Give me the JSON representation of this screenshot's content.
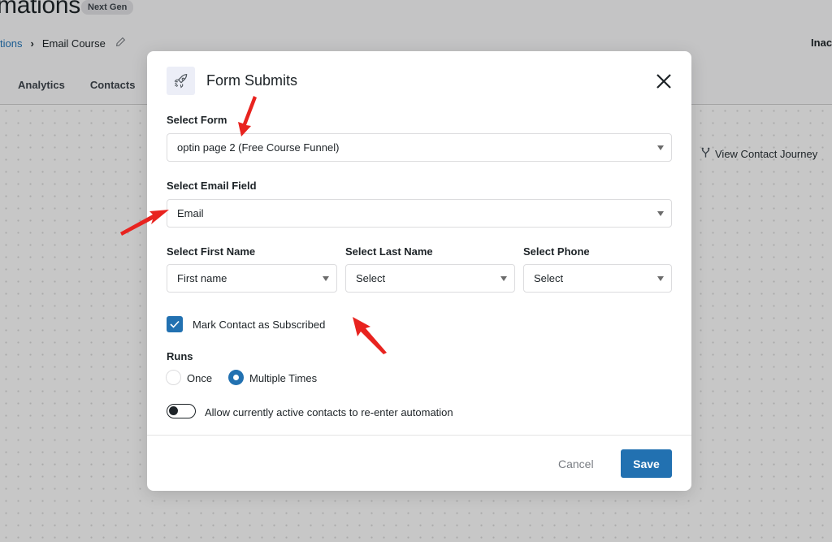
{
  "page": {
    "title": "mations",
    "badge": "Next Gen",
    "breadcrumb": {
      "parent": "tions",
      "separator": "›",
      "current": "Email Course"
    },
    "status": "Inacti",
    "tabs": [
      {
        "label": "Analytics"
      },
      {
        "label": "Contacts"
      }
    ],
    "view_journey": "View Contact Journey"
  },
  "modal": {
    "title": "Form Submits",
    "icon": "rocket-icon",
    "select_form": {
      "label": "Select Form",
      "value": "optin page 2 (Free Course Funnel)"
    },
    "select_email": {
      "label": "Select Email Field",
      "value": "Email"
    },
    "select_first_name": {
      "label": "Select First Name",
      "value": "First name"
    },
    "select_last_name": {
      "label": "Select Last Name",
      "value": "Select"
    },
    "select_phone": {
      "label": "Select Phone",
      "value": "Select"
    },
    "mark_subscribed": {
      "label": "Mark Contact as Subscribed",
      "checked": true
    },
    "runs": {
      "label": "Runs",
      "options": [
        {
          "label": "Once",
          "selected": false
        },
        {
          "label": "Multiple Times",
          "selected": true
        }
      ]
    },
    "reenter": {
      "label": "Allow currently active contacts to re-enter automation",
      "enabled": false
    },
    "cancel_label": "Cancel",
    "save_label": "Save"
  },
  "colors": {
    "accent": "#2271b1",
    "annotation_arrow": "#e8231f"
  }
}
